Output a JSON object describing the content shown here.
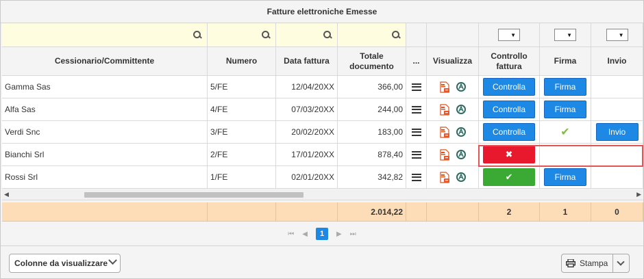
{
  "grid_title": "Fatture elettroniche Emesse",
  "colors": {
    "filter_bg": "#fffde0",
    "button_blue": "#1e88e5",
    "button_red": "#e8192c",
    "button_green": "#3aaa35",
    "totals_bg": "#fddcb8",
    "highlight": "#e05555"
  },
  "columns": {
    "cessionario": "Cessionario/Committente",
    "numero": "Numero",
    "data": "Data fattura",
    "totale_line1": "Totale",
    "totale_line2": "documento",
    "more": "...",
    "visualizza": "Visualizza",
    "controllo_line1": "Controllo",
    "controllo_line2": "fattura",
    "firma": "Firma",
    "invio": "Invio"
  },
  "filters": {
    "search_icon": "search-icon",
    "select_caret": "▼"
  },
  "rows": [
    {
      "cessionario": "Gamma Sas",
      "numero": "5/FE",
      "data": "12/04/20XX",
      "totale": "366,00",
      "controllo": "Controlla",
      "firma": "Firma",
      "invio": ""
    },
    {
      "cessionario": "Alfa Sas",
      "numero": "4/FE",
      "data": "07/03/20XX",
      "totale": "244,00",
      "controllo": "Controlla",
      "firma": "Firma",
      "invio": ""
    },
    {
      "cessionario": "Verdi Snc",
      "numero": "3/FE",
      "data": "20/02/20XX",
      "totale": "183,00",
      "controllo": "Controlla",
      "firma": "✔",
      "invio": "Invio"
    },
    {
      "cessionario": "Bianchi Srl",
      "numero": "2/FE",
      "data": "17/01/20XX",
      "totale": "878,40",
      "controllo": "✖",
      "firma": "",
      "invio": ""
    },
    {
      "cessionario": "Rossi Srl",
      "numero": "1/FE",
      "data": "02/01/20XX",
      "totale": "342,82",
      "controllo": "✔",
      "firma": "Firma",
      "invio": ""
    }
  ],
  "totals": {
    "totale": "2.014,22",
    "controllo": "2",
    "firma": "1",
    "invio": "0"
  },
  "pager": {
    "current_page": "1",
    "first": "⏮",
    "prev": "◀",
    "next": "▶",
    "last": "⏭"
  },
  "toolbar": {
    "columns_button": "Colonne da visualizzare",
    "print_button": "Stampa"
  }
}
